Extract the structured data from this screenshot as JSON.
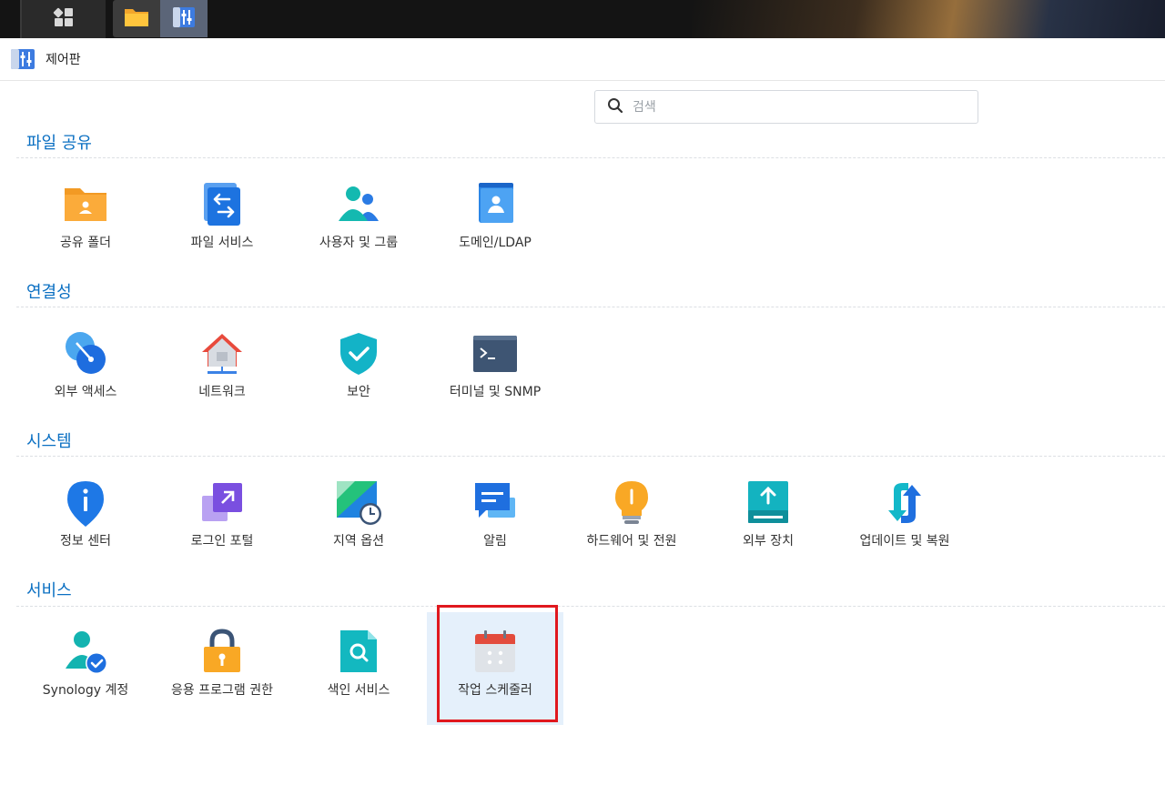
{
  "taskbar": {
    "main_menu_icon": "main-menu-grid-icon",
    "apps": [
      {
        "name": "file-station",
        "icon": "folder-icon"
      },
      {
        "name": "control-panel",
        "icon": "control-panel-icon",
        "active": true
      }
    ]
  },
  "window": {
    "title": "제어판",
    "icon": "control-panel-icon"
  },
  "search": {
    "placeholder": "검색",
    "value": ""
  },
  "sections": [
    {
      "title": "파일 공유",
      "items": [
        {
          "label": "공유 폴더",
          "icon": "shared-folder-icon"
        },
        {
          "label": "파일 서비스",
          "icon": "file-services-icon"
        },
        {
          "label": "사용자 및 그룹",
          "icon": "user-group-icon"
        },
        {
          "label": "도메인/LDAP",
          "icon": "domain-ldap-icon"
        }
      ]
    },
    {
      "title": "연결성",
      "items": [
        {
          "label": "외부 액세스",
          "icon": "external-access-icon"
        },
        {
          "label": "네트워크",
          "icon": "network-icon"
        },
        {
          "label": "보안",
          "icon": "security-shield-icon"
        },
        {
          "label": "터미널 및 SNMP",
          "icon": "terminal-icon"
        }
      ]
    },
    {
      "title": "시스템",
      "items": [
        {
          "label": "정보 센터",
          "icon": "info-center-icon"
        },
        {
          "label": "로그인 포털",
          "icon": "login-portal-icon"
        },
        {
          "label": "지역 옵션",
          "icon": "regional-options-icon"
        },
        {
          "label": "알림",
          "icon": "notification-icon"
        },
        {
          "label": "하드웨어 및 전원",
          "icon": "hardware-power-icon"
        },
        {
          "label": "외부 장치",
          "icon": "external-devices-icon"
        },
        {
          "label": "업데이트 및 복원",
          "icon": "update-restore-icon"
        }
      ]
    },
    {
      "title": "서비스",
      "items": [
        {
          "label": "Synology 계정",
          "icon": "synology-account-icon"
        },
        {
          "label": "응용 프로그램 권한",
          "icon": "application-privileges-icon"
        },
        {
          "label": "색인 서비스",
          "icon": "indexing-service-icon"
        },
        {
          "label": "작업 스케줄러",
          "icon": "task-scheduler-icon",
          "selected": true
        }
      ]
    }
  ],
  "colors": {
    "accent": "#0a6fc2",
    "highlight_border": "#e0181e",
    "selected_bg": "#e5f0fb"
  }
}
